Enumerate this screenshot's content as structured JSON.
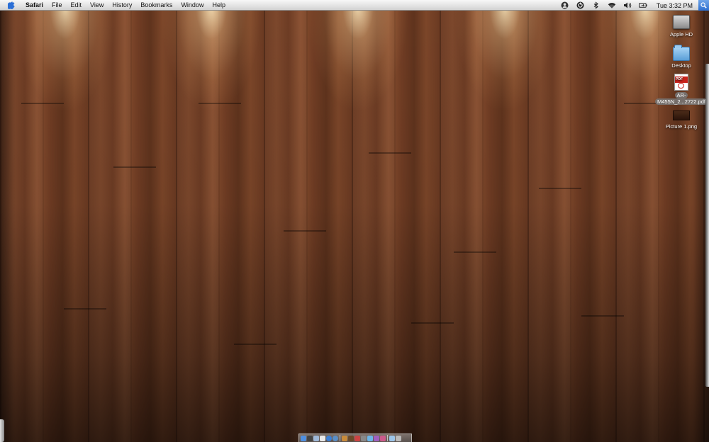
{
  "menubar": {
    "apple_icon": "apple-icon",
    "items": [
      "Safari",
      "File",
      "Edit",
      "View",
      "History",
      "Bookmarks",
      "Window",
      "Help"
    ],
    "status_icons": [
      "user-icon",
      "sync-icon",
      "bluetooth-icon",
      "wifi-icon",
      "volume-icon",
      "battery-icon"
    ],
    "clock": "Tue 3:32 PM",
    "spotlight_icon": "magnifier-icon"
  },
  "desktop": {
    "wallpaper": "wood-planks",
    "icons": [
      {
        "label": "Apple HD",
        "icon": "hard-drive-icon"
      },
      {
        "label": "Desktop",
        "icon": "folder-icon"
      },
      {
        "label_line1": "AR-",
        "label_line2": "M455N_2...2722.pdf",
        "icon": "pdf-icon",
        "badge": "PDF"
      },
      {
        "label": "Picture 1.png",
        "icon": "image-file-icon"
      }
    ]
  },
  "dock": {
    "items": [
      "finder",
      "dashboard",
      "mail",
      "ical",
      "safari",
      "itunes",
      "iphoto",
      "app-store",
      "preview",
      "system-prefs",
      "terminal",
      "downloads",
      "trash"
    ]
  },
  "colors": {
    "menubar_top": "#f7f7f7",
    "menubar_bottom": "#d2d2d2",
    "wood": "#6b3a22",
    "spotlight_blue": "#2d6fd0"
  }
}
